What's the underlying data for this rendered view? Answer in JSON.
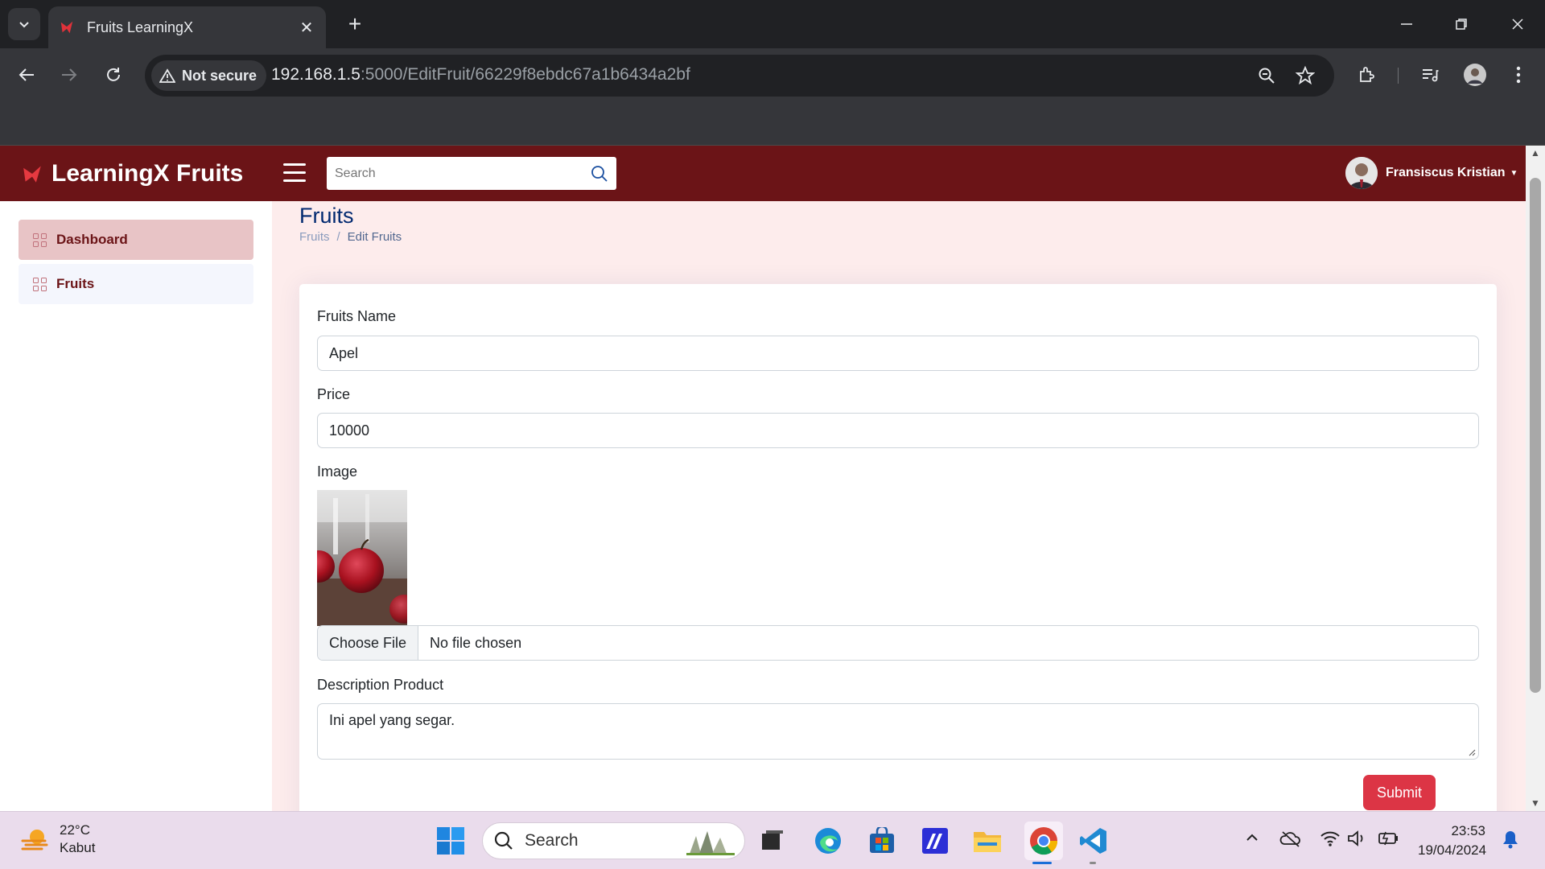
{
  "browser": {
    "tab_title": "Fruits LearningX",
    "security_label": "Not secure",
    "url_host": "192.168.1.5",
    "url_path": ":5000/EditFruit/66229f8ebdc67a1b6434a2bf"
  },
  "app": {
    "brand": "LearningX Fruits",
    "search_placeholder": "Search",
    "user_name": "Fransiscus Kristian"
  },
  "sidebar": {
    "items": [
      {
        "label": "Dashboard",
        "active": true
      },
      {
        "label": "Fruits",
        "active": false
      }
    ]
  },
  "page": {
    "title": "Fruits",
    "breadcrumb": {
      "parent": "Fruits",
      "separator": "/",
      "current": "Edit Fruits"
    }
  },
  "form": {
    "name_label": "Fruits Name",
    "name_value": "Apel",
    "price_label": "Price",
    "price_value": "10000",
    "image_label": "Image",
    "file_button": "Choose File",
    "file_status": "No file chosen",
    "description_label": "Description Product",
    "description_value": "Ini apel yang segar.",
    "submit_label": "Submit"
  },
  "taskbar": {
    "temperature": "22°C",
    "weather": "Kabut",
    "search_label": "Search",
    "time": "23:53",
    "date": "19/04/2024"
  },
  "colors": {
    "navbar": "#6b1417",
    "page_bg": "#fdecec",
    "title": "#012970",
    "submit": "#dc3545"
  }
}
